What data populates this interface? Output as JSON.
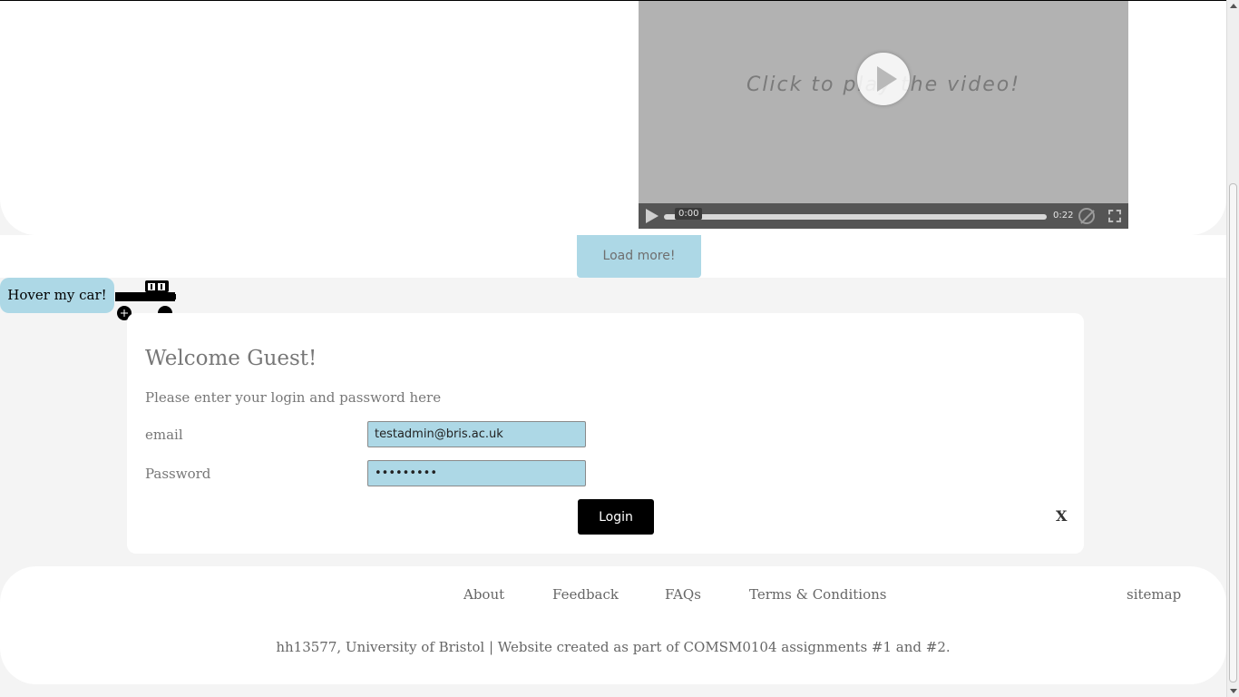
{
  "video": {
    "overlay_text": "Click to play the video!",
    "current_time": "0:00",
    "duration": "0:22"
  },
  "load_more_label": "Load more!",
  "hover_car_label": "Hover my car!",
  "login": {
    "title": "Welcome Guest!",
    "subtitle": "Please enter your login and password here",
    "email_label": "email",
    "email_value": "testadmin@bris.ac.uk",
    "password_label": "Password",
    "password_value": "•••••••••",
    "login_button": "Login",
    "close_label": "X"
  },
  "footer": {
    "links": [
      "About",
      "Feedback",
      "FAQs",
      "Terms & Conditions"
    ],
    "sitemap": "sitemap",
    "info": "hh13577, University of Bristol | Website created as part of COMSM0104 assignments #1 and #2."
  },
  "colors": {
    "accent": "#add8e6",
    "background": "#f4f4f4"
  }
}
